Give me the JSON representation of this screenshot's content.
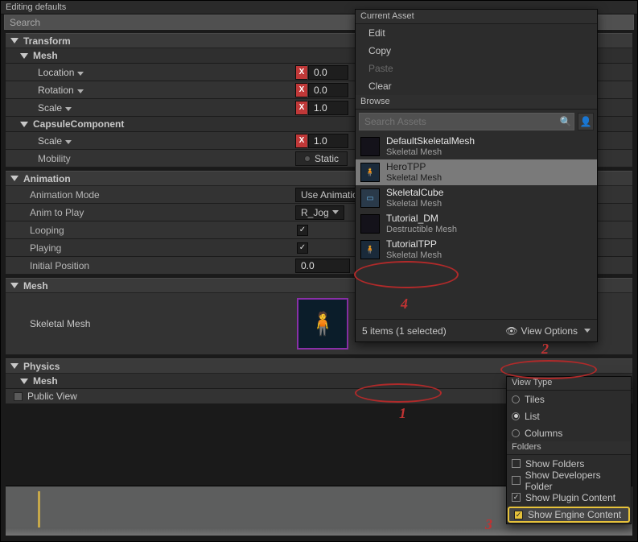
{
  "topbar": {
    "title": "Editing defaults",
    "search_ph": "Search"
  },
  "transform": {
    "header": "Transform",
    "mesh": "Mesh",
    "capsule": "CapsuleComponent",
    "location": "Location",
    "rotation": "Rotation",
    "scale": "Scale",
    "mobility": "Mobility",
    "mob_opts": [
      "Static"
    ],
    "vec0": "0.0",
    "vec1": "1.0"
  },
  "animation": {
    "header": "Animation",
    "mode_lbl": "Animation Mode",
    "mode_val": "Use Animation",
    "anim_lbl": "Anim to Play",
    "anim_val": "R_Jog",
    "looping": "Looping",
    "playing": "Playing",
    "initpos_lbl": "Initial Position",
    "initpos_val": "0.0"
  },
  "mesh": {
    "header": "Mesh",
    "skel_lbl": "Skeletal Mesh",
    "skel_val": "HeroTPP"
  },
  "physics": {
    "header": "Physics",
    "mesh": "Mesh"
  },
  "public_view": "Public View",
  "picker": {
    "current": "Current Asset",
    "edit": "Edit",
    "copy": "Copy",
    "paste": "Paste",
    "clear": "Clear",
    "browse": "Browse",
    "search_ph": "Search Assets",
    "assets": [
      {
        "name": "DefaultSkeletalMesh",
        "type": "Skeletal Mesh"
      },
      {
        "name": "HeroTPP",
        "type": "Skeletal Mesh"
      },
      {
        "name": "SkeletalCube",
        "type": "Skeletal Mesh"
      },
      {
        "name": "Tutorial_DM",
        "type": "Destructible Mesh"
      },
      {
        "name": "TutorialTPP",
        "type": "Skeletal Mesh"
      }
    ],
    "footer": "5 items (1 selected)",
    "view_options": "View Options"
  },
  "viewopts": {
    "view_type": "View Type",
    "tiles": "Tiles",
    "list": "List",
    "columns": "Columns",
    "folders": "Folders",
    "show_folders": "Show Folders",
    "show_dev": "Show Developers Folder",
    "show_plugin": "Show Plugin Content",
    "show_engine": "Show Engine Content"
  },
  "anno": {
    "n1": "1",
    "n2": "2",
    "n3": "3",
    "n4": "4"
  }
}
